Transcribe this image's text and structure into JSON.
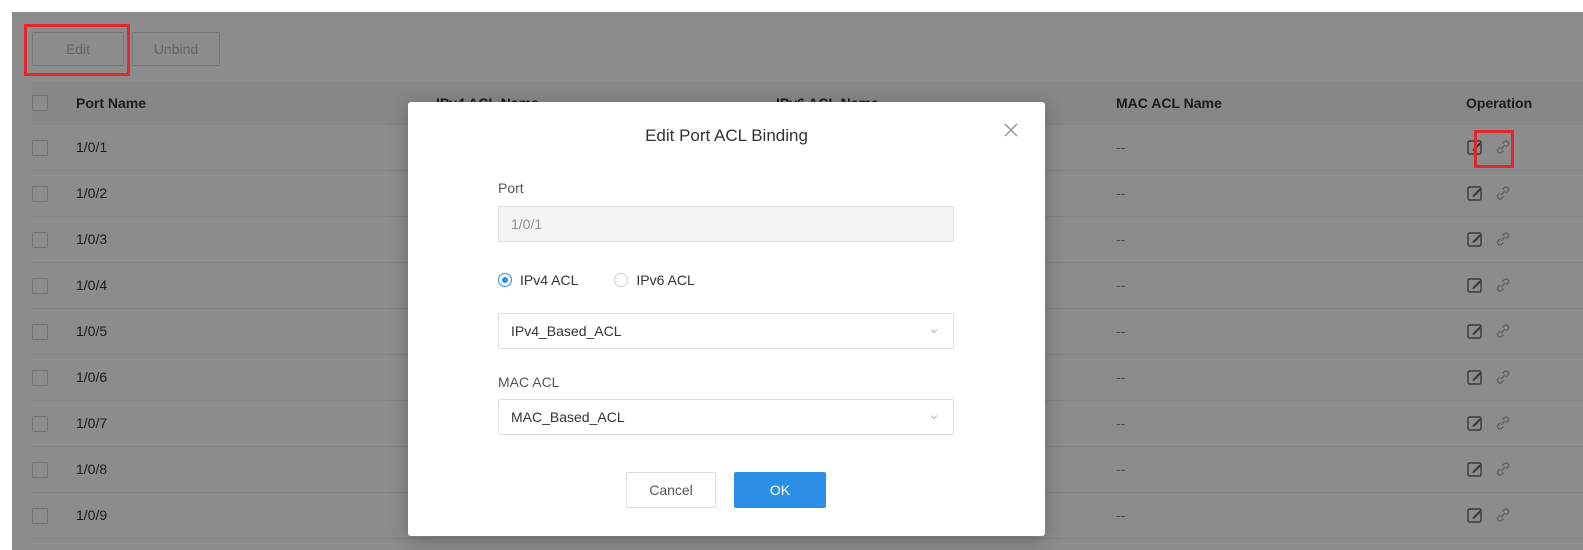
{
  "toolbar": {
    "edit_label": "Edit",
    "unbind_label": "Unbind"
  },
  "table": {
    "columns": [
      "Port Name",
      "IPv4 ACL Name",
      "IPv6 ACL Name",
      "MAC ACL Name",
      "Operation"
    ],
    "rows": [
      {
        "port": "1/0/1",
        "mac": "--"
      },
      {
        "port": "1/0/2",
        "mac": "--"
      },
      {
        "port": "1/0/3",
        "mac": "--"
      },
      {
        "port": "1/0/4",
        "mac": "--"
      },
      {
        "port": "1/0/5",
        "mac": "--"
      },
      {
        "port": "1/0/6",
        "mac": "--"
      },
      {
        "port": "1/0/7",
        "mac": "--"
      },
      {
        "port": "1/0/8",
        "mac": "--"
      },
      {
        "port": "1/0/9",
        "mac": "--"
      }
    ]
  },
  "modal": {
    "title": "Edit Port ACL Binding",
    "port_label": "Port",
    "port_value": "1/0/1",
    "radio_ipv4": "IPv4 ACL",
    "radio_ipv6": "IPv6 ACL",
    "selected_acl_type": "IPv4 ACL",
    "acl_select_value": "IPv4_Based_ACL",
    "mac_label": "MAC ACL",
    "mac_select_value": "MAC_Based_ACL",
    "cancel_label": "Cancel",
    "ok_label": "OK"
  },
  "colors": {
    "accent": "#2c8fe6",
    "highlight": "#e0282e"
  }
}
